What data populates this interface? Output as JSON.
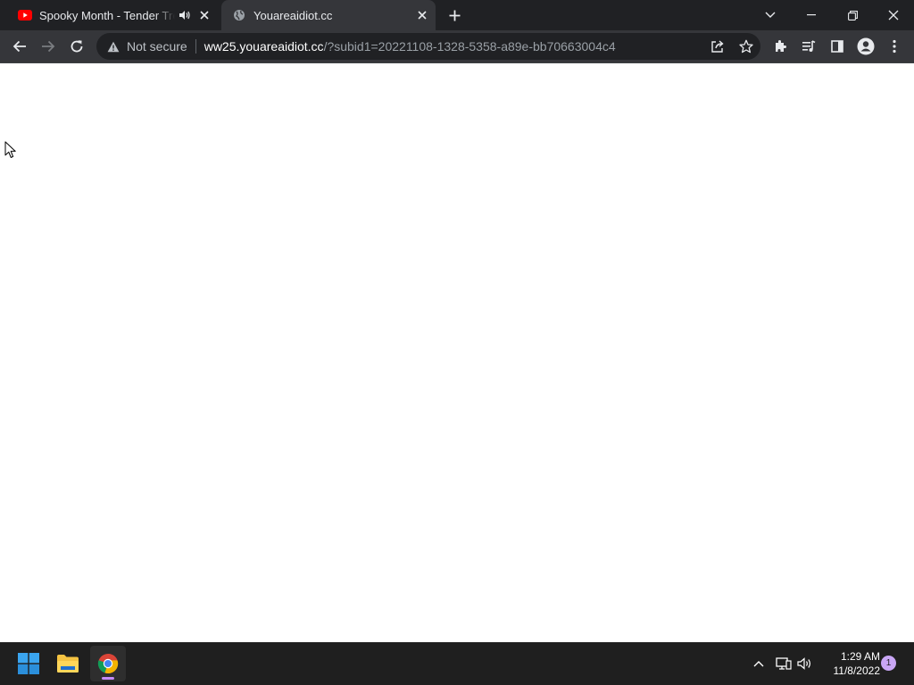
{
  "tabs": [
    {
      "title": "Spooky Month - Tender Treat",
      "favicon": "youtube-icon",
      "audio": true
    },
    {
      "title": "Youareaidiot.cc",
      "favicon": "globe-icon"
    }
  ],
  "toolbar": {
    "security_label": "Not secure",
    "url_host": "ww25.youareaidiot.cc",
    "url_rest": "/?subid1=20221108-1328-5358-a89e-bb70663004c4"
  },
  "taskbar": {
    "time": "1:29 AM",
    "date": "11/8/2022",
    "notification_count": "1"
  },
  "colors": {
    "tabbar_bg": "#202124",
    "toolbar_bg": "#35363a",
    "taskbar_bg": "#1f1f1f",
    "page_bg": "#ffffff"
  }
}
